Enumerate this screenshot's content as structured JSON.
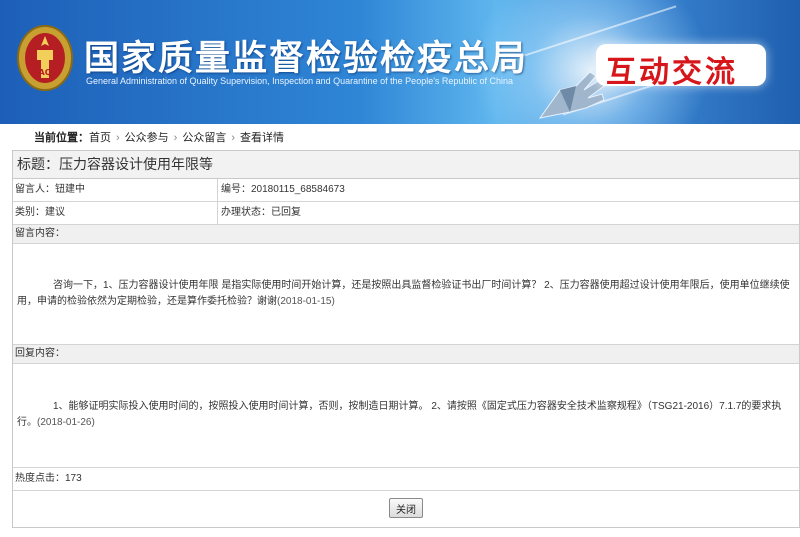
{
  "header": {
    "title": "国家质量监督检验检疫总局",
    "subtitle": "General Administration of Quality Supervision, Inspection and Quarantine of the People's Republic of China",
    "badge": "互动交流",
    "emblem_icon": "national-emblem-icon"
  },
  "breadcrumb": {
    "label": "当前位置：",
    "items": [
      "首页",
      "公众参与",
      "公众留言",
      "查看详情"
    ],
    "separator": "›"
  },
  "detail": {
    "title": "标题：压力容器设计使用年限等",
    "author_label": "留言人：",
    "author": "钮建中",
    "number_label": "编号：",
    "number": "20180115_68584673",
    "category_label": "类别：",
    "category": "建议",
    "status_label": "办理状态：",
    "status": "已回复",
    "message_label": "留言内容：",
    "message": "咨询一下，1、压力容器设计使用年限 是指实际使用时间开始计算，还是按照出具监督检验证书出厂时间计算？ 2、压力容器使用超过设计使用年限后，使用单位继续使用，申请的检验依然为定期检验，还是算作委托检验？谢谢",
    "message_date": "(2018-01-15)",
    "reply_label": "回复内容：",
    "reply": "1、能够证明实际投入使用时间的，按照投入使用时间计算，否则，按制造日期计算。 2、请按照《固定式压力容器安全技术监察规程》（TSG21-2016）7.1.7的要求执行。",
    "reply_date": "(2018-01-26)",
    "hits_label": "热度点击：",
    "hits": "173",
    "close_label": "关闭"
  },
  "colors": {
    "banner_blue": "#2f86d6",
    "badge_red": "#d7161b",
    "border": "#c9c9c9"
  }
}
